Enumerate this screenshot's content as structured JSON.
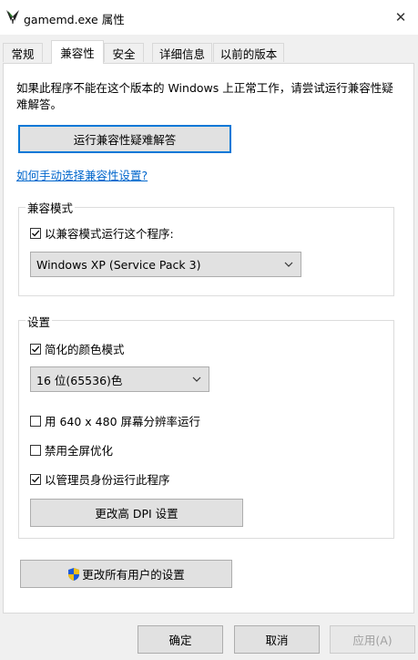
{
  "window": {
    "title": "gamemd.exe 属性",
    "close_symbol": "✕"
  },
  "tabs": [
    "常规",
    "兼容性",
    "安全",
    "详细信息",
    "以前的版本"
  ],
  "active_tab": "兼容性",
  "intro": "如果此程序不能在这个版本的 Windows 上正常工作，请尝试运行兼容性疑难解答。",
  "troubleshooter_button": "运行兼容性疑难解答",
  "manual_link": "如何手动选择兼容性设置?",
  "compat_mode": {
    "group_label": "兼容模式",
    "checkbox_label": "以兼容模式运行这个程序:",
    "checked": true,
    "selected_os": "Windows XP (Service Pack 3)"
  },
  "settings": {
    "group_label": "设置",
    "reduced_color": {
      "label": "简化的颜色模式",
      "checked": true
    },
    "color_select": "16 位(65536)色",
    "res_640": {
      "label": "用 640 x 480 屏幕分辨率运行",
      "checked": false
    },
    "disable_fullscreen": {
      "label": "禁用全屏优化",
      "checked": false
    },
    "run_as_admin": {
      "label": "以管理员身份运行此程序",
      "checked": true
    },
    "dpi_button": "更改高 DPI 设置"
  },
  "all_users_button": "更改所有用户的设置",
  "footer": {
    "ok": "确定",
    "cancel": "取消",
    "apply": "应用(A)"
  },
  "colors": {
    "accent": "#0078d7",
    "link": "#0066cc",
    "shield_blue": "#1e5bd8",
    "shield_yellow": "#f2c01a"
  }
}
